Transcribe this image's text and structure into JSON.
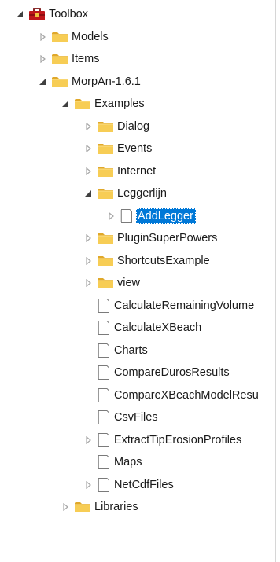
{
  "tree": {
    "items": [
      {
        "label": "Toolbox",
        "depth": 0,
        "expander": "expanded",
        "icon": "toolbox-icon",
        "selected": false
      },
      {
        "label": "Models",
        "depth": 1,
        "expander": "collapsed",
        "icon": "folder-icon",
        "selected": false
      },
      {
        "label": "Items",
        "depth": 1,
        "expander": "collapsed",
        "icon": "folder-icon",
        "selected": false
      },
      {
        "label": "MorpAn-1.6.1",
        "depth": 1,
        "expander": "expanded",
        "icon": "folder-icon",
        "selected": false
      },
      {
        "label": "Examples",
        "depth": 2,
        "expander": "expanded",
        "icon": "folder-icon",
        "selected": false
      },
      {
        "label": "Dialog",
        "depth": 3,
        "expander": "collapsed",
        "icon": "folder-icon",
        "selected": false
      },
      {
        "label": "Events",
        "depth": 3,
        "expander": "collapsed",
        "icon": "folder-icon",
        "selected": false
      },
      {
        "label": "Internet",
        "depth": 3,
        "expander": "collapsed",
        "icon": "folder-icon",
        "selected": false
      },
      {
        "label": "Leggerlijn",
        "depth": 3,
        "expander": "expanded",
        "icon": "folder-icon",
        "selected": false
      },
      {
        "label": "AddLegger",
        "depth": 4,
        "expander": "collapsed",
        "icon": "document-icon",
        "selected": true
      },
      {
        "label": "PluginSuperPowers",
        "depth": 3,
        "expander": "collapsed",
        "icon": "folder-icon",
        "selected": false
      },
      {
        "label": "ShortcutsExample",
        "depth": 3,
        "expander": "collapsed",
        "icon": "folder-icon",
        "selected": false
      },
      {
        "label": "view",
        "depth": 3,
        "expander": "collapsed",
        "icon": "folder-icon",
        "selected": false
      },
      {
        "label": "CalculateRemainingVolume",
        "depth": 3,
        "expander": "none",
        "icon": "document-icon",
        "selected": false
      },
      {
        "label": "CalculateXBeach",
        "depth": 3,
        "expander": "none",
        "icon": "document-icon",
        "selected": false
      },
      {
        "label": "Charts",
        "depth": 3,
        "expander": "none",
        "icon": "document-icon",
        "selected": false
      },
      {
        "label": "CompareDurosResults",
        "depth": 3,
        "expander": "none",
        "icon": "document-icon",
        "selected": false
      },
      {
        "label": "CompareXBeachModelResu",
        "depth": 3,
        "expander": "none",
        "icon": "document-icon",
        "selected": false
      },
      {
        "label": "CsvFiles",
        "depth": 3,
        "expander": "none",
        "icon": "document-icon",
        "selected": false
      },
      {
        "label": "ExtractTipErosionProfiles",
        "depth": 3,
        "expander": "collapsed",
        "icon": "document-icon",
        "selected": false
      },
      {
        "label": "Maps",
        "depth": 3,
        "expander": "none",
        "icon": "document-icon",
        "selected": false
      },
      {
        "label": "NetCdfFiles",
        "depth": 3,
        "expander": "collapsed",
        "icon": "document-icon",
        "selected": false
      },
      {
        "label": "Libraries",
        "depth": 2,
        "expander": "collapsed",
        "icon": "folder-icon",
        "selected": false
      }
    ]
  }
}
